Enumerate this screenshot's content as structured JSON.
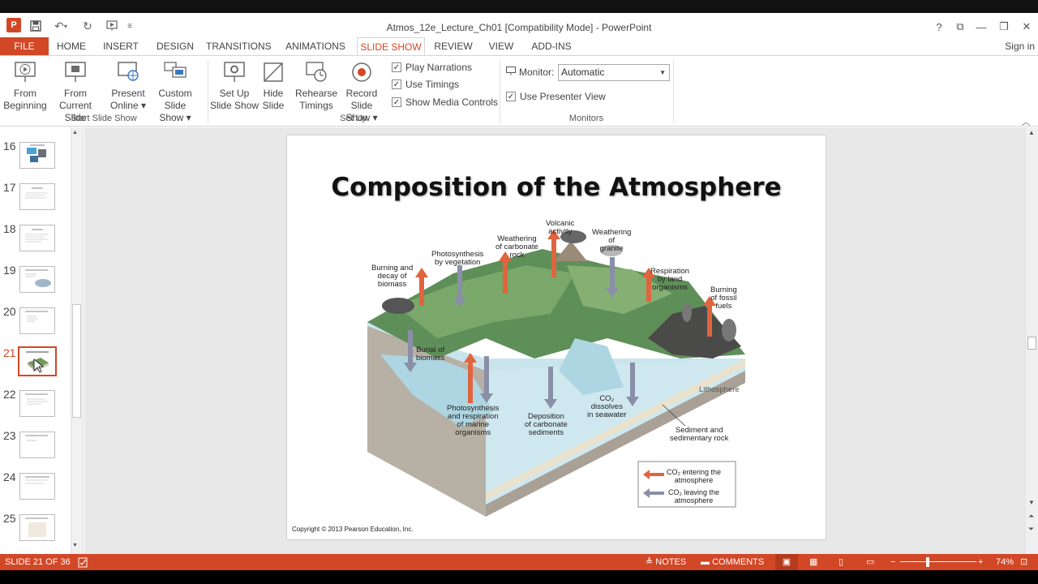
{
  "window": {
    "title": "Atmos_12e_Lecture_Ch01 [Compatibility Mode] - PowerPoint",
    "controls": [
      "?",
      "⧉",
      "—",
      "❐",
      "✕"
    ]
  },
  "tabs": {
    "file": "FILE",
    "items": [
      "HOME",
      "INSERT",
      "DESIGN",
      "TRANSITIONS",
      "ANIMATIONS",
      "SLIDE SHOW",
      "REVIEW",
      "VIEW",
      "ADD-INS"
    ],
    "active": "SLIDE SHOW",
    "signin": "Sign in"
  },
  "ribbon": {
    "from_beginning": [
      "From",
      "Beginning"
    ],
    "from_current": [
      "From",
      "Current Slide"
    ],
    "present_online": [
      "Present",
      "Online ▾"
    ],
    "custom_show": [
      "Custom Slide",
      "Show ▾"
    ],
    "group_start": "Start Slide Show",
    "setup_show": [
      "Set Up",
      "Slide Show"
    ],
    "hide_slide": [
      "Hide",
      "Slide"
    ],
    "rehearse": [
      "Rehearse",
      "Timings"
    ],
    "record": [
      "Record Slide",
      "Show ▾"
    ],
    "play_narrations": "Play Narrations",
    "use_timings": "Use Timings",
    "show_media_controls": "Show Media Controls",
    "group_setup": "Set Up",
    "monitor_label": "Monitor:",
    "monitor_value": "Automatic",
    "presenter_view": "Use Presenter View",
    "group_monitors": "Monitors"
  },
  "thumbnails": {
    "numbers": [
      "16",
      "17",
      "18",
      "19",
      "20",
      "21",
      "22",
      "23",
      "24",
      "25"
    ],
    "active": "21"
  },
  "slide": {
    "title": "Composition of the Atmosphere",
    "labels": {
      "burning_decay": [
        "Burning and",
        "decay of",
        "biomass"
      ],
      "photosynthesis_veg": [
        "Photosynthesis",
        "by vegetation"
      ],
      "weathering_carbonate": [
        "Weathering",
        "of carbonate",
        "rock"
      ],
      "volcanic": [
        "Volcanic",
        "activity"
      ],
      "weathering_granite": [
        "Weathering",
        "of",
        "granite"
      ],
      "respiration_land": [
        "Respiration",
        "by land",
        "organisms"
      ],
      "burning_fossil": [
        "Burning",
        "of fossil",
        "fuels"
      ],
      "burial": [
        "Burial of",
        "biomass"
      ],
      "marine": [
        "Photosynthesis",
        "and respiration",
        "of marine",
        "organisms"
      ],
      "deposition": [
        "Deposition",
        "of carbonate",
        "sediments"
      ],
      "co2_dissolves": [
        "CO₂",
        "dissolves",
        "in seawater"
      ],
      "lithosphere": "Lithosphere",
      "sediment": [
        "Sediment and",
        "sedimentary rock"
      ],
      "legend_enter": [
        "CO₂ entering the",
        "atmosphere"
      ],
      "legend_leave": [
        "CO₂ leaving the",
        "atmosphere"
      ]
    },
    "copyright": "Copyright © 2013 Pearson Education, Inc."
  },
  "status": {
    "slide_count": "SLIDE 21 OF 36",
    "notes": "NOTES",
    "comments": "COMMENTS",
    "zoom": "74%",
    "minus": "−",
    "plus": "+"
  },
  "colors": {
    "accent": "#d24726",
    "arrow_up": "#e0643e",
    "arrow_down": "#8a8fa8"
  }
}
